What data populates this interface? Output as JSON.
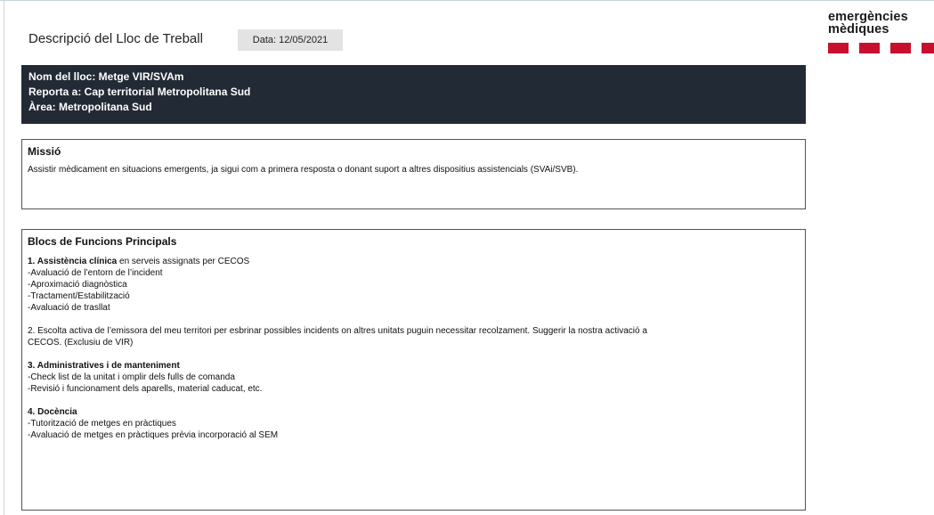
{
  "document": {
    "title": "Descripció del Lloc de Treball",
    "date": "Data: 12/05/2021"
  },
  "logo": {
    "line1": "emergències",
    "line2": "mèdiques",
    "color": "#c8102e"
  },
  "header": {
    "name_line": "Nom del lloc: Metge VIR/SVAm",
    "reports_line": "Reporta a: Cap territorial Metropolitana Sud",
    "area_line": "Àrea: Metropolitana Sud",
    "background": "#222a35"
  },
  "mission": {
    "title": "Missió",
    "text": "Assistir mèdicament en situacions emergents, ja sigui com a primera resposta o donant suport a altres dispositius assistencials (SVAi/SVB)."
  },
  "blocs": {
    "title": "Blocs de Funcions Principals",
    "group1": {
      "heading": "1. Assistència clínica",
      "heading_rest": " en serveis assignats per CECOS",
      "items": [
        "-Avaluació de l’entorn de l’incident",
        "-Aproximació diagnòstica",
        "-Tractament/Estabilització",
        "-Avaluació de trasllat"
      ]
    },
    "group2": {
      "line1": "2. Escolta activa de l’emissora del meu territori per esbrinar possibles incidents on altres unitats puguin necessitar recolzament. Suggerir la nostra activació a",
      "line2": "CECOS. (Exclusiu de VIR)"
    },
    "group3": {
      "heading": "3. Administratives i de manteniment",
      "items": [
        "-Check list de la unitat i omplir dels fulls de comanda",
        "-Revisió i funcionament dels aparells, material caducat, etc."
      ]
    },
    "group4": {
      "heading": "4. Docència",
      "items": [
        "-Tutorització de metges en pràctiques",
        "-Avaluació de metges en pràctiques prèvia incorporació al SEM"
      ]
    }
  }
}
